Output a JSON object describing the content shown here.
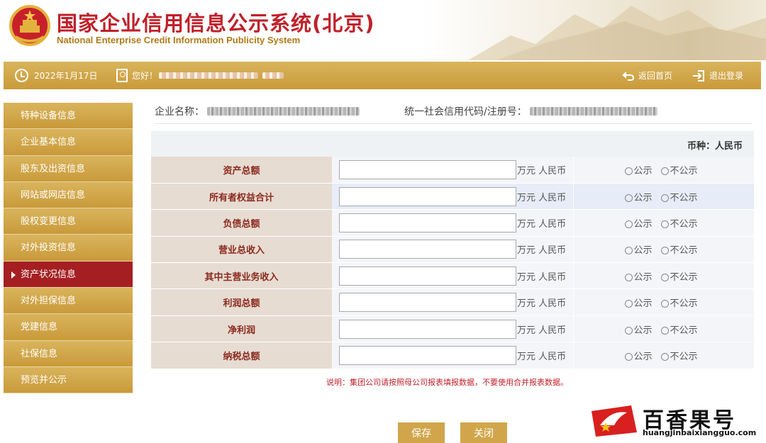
{
  "header": {
    "title_cn_main": "国家企业信用信息公示系统",
    "title_cn_region": "(北京)",
    "title_en": "National Enterprise Credit Information Publicity System"
  },
  "topbar": {
    "date": "2022年1月17日",
    "greeting": "您好！",
    "home_label": "返回首页",
    "logout_label": "退出登录"
  },
  "sidebar": {
    "items": [
      {
        "label": "特种设备信息",
        "active": false
      },
      {
        "label": "企业基本信息",
        "active": false
      },
      {
        "label": "股东及出资信息",
        "active": false
      },
      {
        "label": "网站或网店信息",
        "active": false
      },
      {
        "label": "股权变更信息",
        "active": false
      },
      {
        "label": "对外投资信息",
        "active": false
      },
      {
        "label": "资产状况信息",
        "active": true
      },
      {
        "label": "对外担保信息",
        "active": false
      },
      {
        "label": "党建信息",
        "active": false
      },
      {
        "label": "社保信息",
        "active": false
      },
      {
        "label": "预览并公示",
        "active": false
      }
    ]
  },
  "company": {
    "name_label": "企业名称：",
    "code_label": "统一社会信用代码/注册号："
  },
  "currency": "币种：人民币",
  "rows": [
    {
      "label": "资产总额",
      "value": "",
      "unit": "万元 人民币",
      "public": "公示",
      "private": "不公示"
    },
    {
      "label": "所有者权益合计",
      "value": "",
      "unit": "万元 人民币",
      "public": "公示",
      "private": "不公示"
    },
    {
      "label": "负债总额",
      "value": "",
      "unit": "万元 人民币",
      "public": "公示",
      "private": "不公示"
    },
    {
      "label": "营业总收入",
      "value": "",
      "unit": "万元 人民币",
      "public": "公示",
      "private": "不公示"
    },
    {
      "label": "其中主营业务收入",
      "value": "",
      "unit": "万元 人民币",
      "public": "公示",
      "private": "不公示"
    },
    {
      "label": "利润总额",
      "value": "",
      "unit": "万元 人民币",
      "public": "公示",
      "private": "不公示"
    },
    {
      "label": "净利润",
      "value": "",
      "unit": "万元 人民币",
      "public": "公示",
      "private": "不公示"
    },
    {
      "label": "纳税总额",
      "value": "",
      "unit": "万元 人民币",
      "public": "公示",
      "private": "不公示"
    }
  ],
  "note": "说明：集团公司请按照母公司报表填报数据，不要使用合并报表数据。",
  "buttons": {
    "save": "保存",
    "close": "关闭"
  },
  "watermark": {
    "name": "百香果号",
    "url": "huangjinbaixiangguo.com"
  },
  "colors": {
    "gold": "#c99a3a",
    "active": "#a51f22",
    "title": "#c0202a"
  }
}
